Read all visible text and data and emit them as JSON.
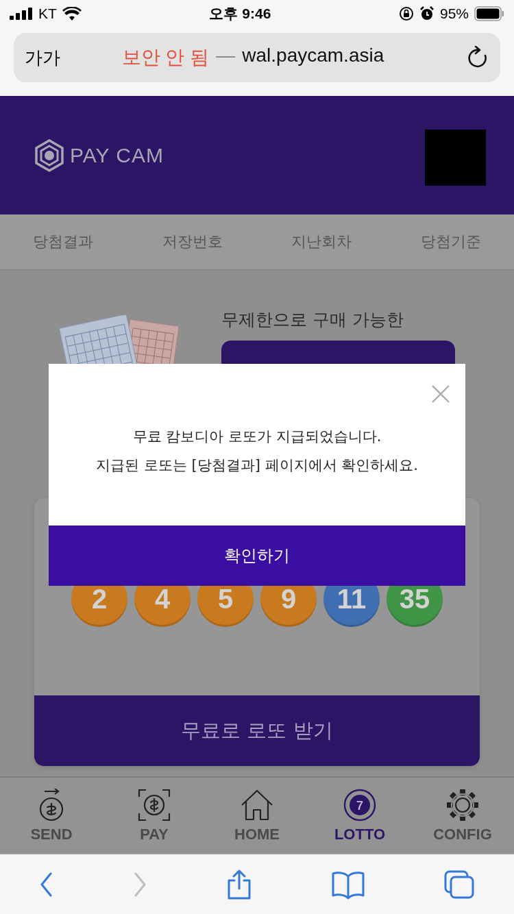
{
  "status_bar": {
    "carrier": "KT",
    "time": "오후 9:46",
    "battery": "95%"
  },
  "address_bar": {
    "text_size": "가가",
    "security": "보안 안 됨",
    "separator": "—",
    "url": "wal.paycam.asia"
  },
  "header": {
    "logo": "PAY CAM"
  },
  "tabs": [
    {
      "label": "당첨결과"
    },
    {
      "label": "저장번호"
    },
    {
      "label": "지난회차"
    },
    {
      "label": "당첨기준"
    }
  ],
  "promo": {
    "text": "무제한으로 구매 가능한"
  },
  "balls": [
    {
      "number": "2",
      "color": "#c97a1e"
    },
    {
      "number": "4",
      "color": "#c97a1e"
    },
    {
      "number": "5",
      "color": "#c97a1e"
    },
    {
      "number": "9",
      "color": "#c97a1e"
    },
    {
      "number": "11",
      "color": "#3f6fb0"
    },
    {
      "number": "35",
      "color": "#3f9446"
    }
  ],
  "free_button": "무료로 로또 받기",
  "bottom_nav": [
    {
      "kind": "send",
      "label": "SEND",
      "selected": false
    },
    {
      "kind": "pay",
      "label": "PAY",
      "selected": false
    },
    {
      "kind": "home",
      "label": "HOME",
      "selected": false
    },
    {
      "kind": "lotto",
      "label": "LOTTO",
      "selected": true,
      "badge": "7"
    },
    {
      "kind": "config",
      "label": "CONFIG",
      "selected": false
    }
  ],
  "browser_toolbar": [
    {
      "kind": "back",
      "disabled": false
    },
    {
      "kind": "forward",
      "disabled": true
    },
    {
      "kind": "share",
      "disabled": false
    },
    {
      "kind": "bookmarks",
      "disabled": false
    },
    {
      "kind": "tabs",
      "disabled": false
    }
  ],
  "dialog": {
    "message_lines": [
      "무료 캄보디아 로또가 지급되었습니다.",
      "지급된 로또는 [당첨결과] 페이지에서 확인하세요."
    ],
    "confirm": "확인하기"
  }
}
